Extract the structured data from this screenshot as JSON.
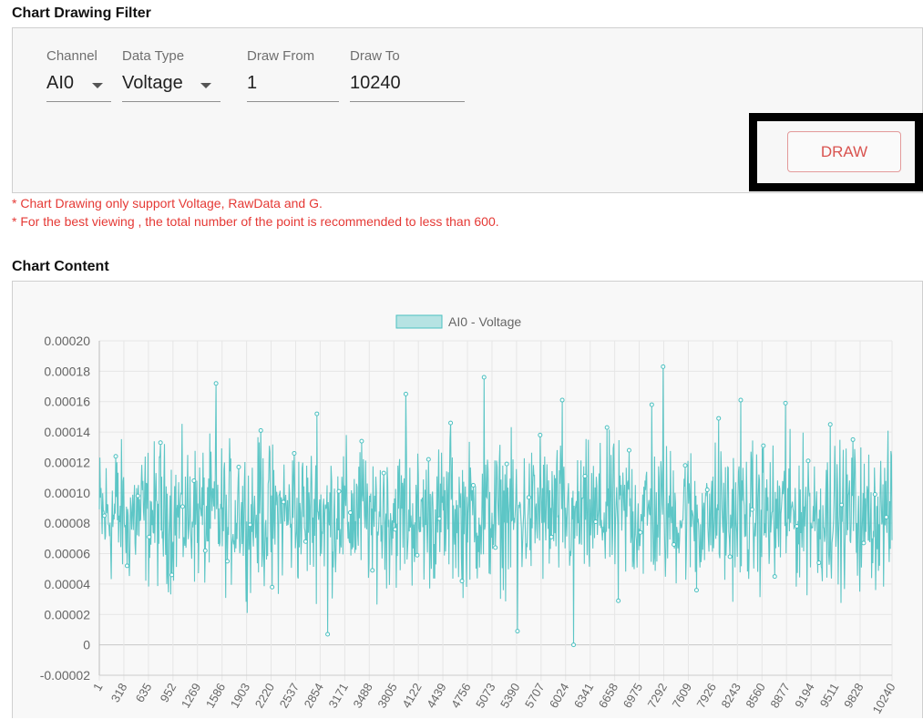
{
  "filter": {
    "title": "Chart Drawing Filter",
    "channel": {
      "label": "Channel",
      "value": "AI0"
    },
    "data_type": {
      "label": "Data Type",
      "value": "Voltage"
    },
    "draw_from": {
      "label": "Draw From",
      "value": "1"
    },
    "draw_to": {
      "label": "Draw To",
      "value": "10240"
    },
    "draw_button": "DRAW"
  },
  "notes": [
    "* Chart Drawing only support Voltage, RawData and G.",
    "* For the best viewing , the total number of the point is recommended to less than 600."
  ],
  "chart_section": {
    "title": "Chart Content"
  },
  "colors": {
    "series": "#4bc0c0",
    "series_fill": "#b6e3e3",
    "note": "#e53935",
    "draw_button": "#d9534f"
  },
  "chart_data": {
    "type": "line",
    "legend": "AI0 - Voltage",
    "legend_position": "top",
    "grid": true,
    "x_range": [
      1,
      10240
    ],
    "ylim": [
      -2e-05,
      0.0002
    ],
    "y_ticks": [
      "0.00020",
      "0.00018",
      "0.00016",
      "0.00014",
      "0.00012",
      "0.00010",
      "0.00008",
      "0.00006",
      "0.00004",
      "0.00002",
      "0",
      "-0.00002"
    ],
    "x_ticks": [
      "1",
      "318",
      "635",
      "952",
      "1269",
      "1586",
      "1903",
      "2220",
      "2537",
      "2854",
      "3171",
      "3488",
      "3805",
      "4122",
      "4439",
      "4756",
      "5073",
      "5390",
      "5707",
      "6024",
      "6341",
      "6658",
      "6975",
      "7292",
      "7609",
      "7926",
      "8243",
      "8560",
      "8877",
      "9194",
      "9511",
      "9828",
      "10240"
    ],
    "series": [
      {
        "name": "AI0 - Voltage",
        "summary": {
          "typical_min": 4e-05,
          "typical_max": 0.00013,
          "center": 8.5e-05
        },
        "values_sampled": [
          8.5e-05,
          0.000124,
          5.2e-05,
          9.8e-05,
          7.1e-05,
          0.000133,
          4.6e-05,
          9.1e-05,
          0.000108,
          6.2e-05,
          0.000172,
          5.5e-05,
          0.000117,
          7.9e-05,
          0.000141,
          3.8e-05,
          9.4e-05,
          0.000126,
          6.8e-05,
          0.000152,
          7e-06,
          0.000101,
          8.7e-05,
          0.000134,
          4.9e-05,
          0.000113,
          7.6e-05,
          0.000165,
          5.9e-05,
          0.000122,
          8.3e-05,
          0.000146,
          4.2e-05,
          0.000105,
          0.000176,
          6.4e-05,
          0.000119,
          9e-06,
          9.7e-05,
          0.000138,
          7.1e-05,
          0.000161,
          0.0,
          0.000111,
          8.1e-05,
          0.000143,
          2.9e-05,
          0.000128,
          7.4e-05,
          0.000158,
          0.000183,
          6.6e-05,
          0.000118,
          3.6e-05,
          0.000102,
          0.000149,
          5.8e-05,
          0.000161,
          8.9e-05,
          0.000131,
          4.5e-05,
          0.000159,
          7.8e-05,
          0.000121,
          5.4e-05,
          0.000145,
          9.2e-05,
          0.000135,
          6.7e-05,
          9.9e-05,
          8.4e-05
        ]
      }
    ]
  }
}
